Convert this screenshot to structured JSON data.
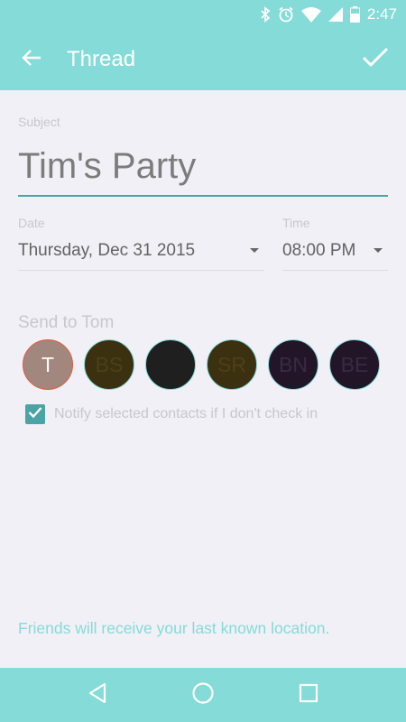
{
  "status_bar": {
    "time": "2:47",
    "icons": [
      "bluetooth-icon",
      "alarm-icon",
      "wifi-icon",
      "signal-icon",
      "battery-icon"
    ]
  },
  "app_bar": {
    "title": "Thread",
    "back_icon": "arrow-left-icon",
    "confirm_icon": "checkmark-icon"
  },
  "form": {
    "subject_label": "Subject",
    "subject_value": "Tim's Party",
    "date_label": "Date",
    "date_value": "Thursday, Dec 31 2015",
    "time_label": "Time",
    "time_value": "08:00 PM",
    "send_to_label": "Send to Tom",
    "contacts": [
      {
        "initials": "T",
        "bg": "#a2877f",
        "fg": "#ffffff",
        "selected": true
      },
      {
        "initials": "BS",
        "bg": "#3b3010",
        "fg": "#4d4018",
        "selected": false
      },
      {
        "initials": "",
        "bg": "#1f1f1f",
        "fg": "#3a3a3a",
        "selected": false
      },
      {
        "initials": "SR",
        "bg": "#3b3010",
        "fg": "#4d4018",
        "selected": false
      },
      {
        "initials": "BN",
        "bg": "#221528",
        "fg": "#3a2a42",
        "selected": false
      },
      {
        "initials": "BE",
        "bg": "#221528",
        "fg": "#3a2a42",
        "selected": false
      }
    ],
    "notify_checked": true,
    "notify_text": "Notify selected contacts if I don't check in"
  },
  "footer_note": "Friends will receive your last known location.",
  "colors": {
    "accent": "#84dbd8",
    "accent_dark": "#4aa3a5",
    "selected_border": "#e35a35",
    "background": "#f1f0f6"
  },
  "nav_bar": {
    "icons": [
      "back-triangle-icon",
      "home-circle-icon",
      "recents-square-icon"
    ]
  }
}
